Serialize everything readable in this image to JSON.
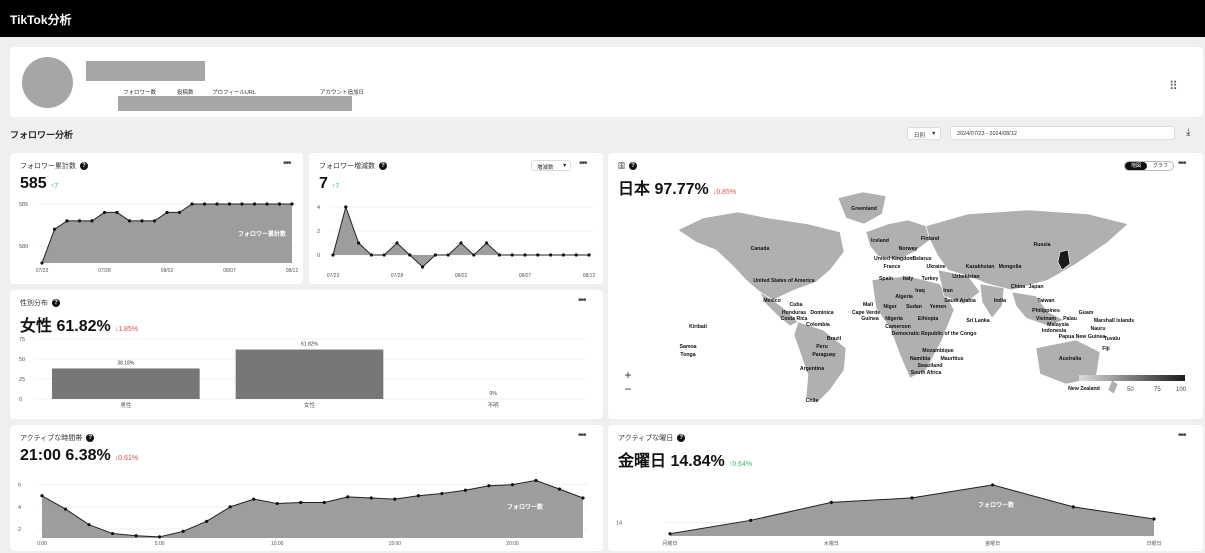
{
  "app": {
    "title": "TikTok分析"
  },
  "profile": {
    "labels": [
      "フォロワー数",
      "投稿数",
      "プロフィールURL",
      "アカウント追加日"
    ]
  },
  "follower_section": {
    "title": "フォロワー分析",
    "period_select": "日別",
    "date_range": "2024/07/23 - 2024/08/12"
  },
  "cards": {
    "total_followers": {
      "title": "フォロワー累計数",
      "value": "585",
      "delta": "↑7",
      "chart_data": {
        "type": "area",
        "series": [
          {
            "name": "フォロワー累計数",
            "values": [
              578,
              582,
              583,
              583,
              583,
              584,
              584,
              583,
              583,
              583,
              584,
              584,
              585,
              585,
              585,
              585,
              585,
              585,
              585,
              585,
              585
            ]
          }
        ],
        "x_ticks": [
          "07/23",
          "07/28",
          "08/02",
          "08/07",
          "08/12"
        ],
        "y_ticks": [
          "585",
          "580"
        ],
        "ylim": [
          578,
          585
        ]
      }
    },
    "follower_change": {
      "title": "フォロワー増減数",
      "select": "増減数",
      "value": "7",
      "delta": "↑7",
      "chart_data": {
        "type": "area",
        "series": [
          {
            "name": "フォロワー増減数",
            "values": [
              0,
              4,
              1,
              0,
              0,
              1,
              0,
              -1,
              0,
              0,
              1,
              0,
              1,
              0,
              0,
              0,
              0,
              0,
              0,
              0,
              0
            ]
          }
        ],
        "x_ticks": [
          "07/23",
          "07/28",
          "08/02",
          "08/07",
          "08/12"
        ],
        "y_ticks": [
          "4",
          "2",
          "0"
        ],
        "ylim": [
          -1,
          4
        ]
      }
    },
    "country": {
      "title": "国",
      "value": "日本 97.77%",
      "delta": "↓0.85%",
      "toggle": [
        "地図",
        "グラフ"
      ],
      "labels": [
        "Greenland",
        "Iceland",
        "Finland",
        "Norway",
        "Russia",
        "Canada",
        "United Kingdom",
        "Belarus",
        "France",
        "Ukraine",
        "Kazakhstan",
        "Mongolia",
        "Spain",
        "Italy",
        "Turkey",
        "Uzbekistan",
        "United States of America",
        "China",
        "Iraq",
        "Iran",
        "Japan",
        "Algeria",
        "Saudi Arabia",
        "India",
        "Taiwan",
        "Mexico",
        "Cuba",
        "Mali",
        "Niger",
        "Sudan",
        "Yemen",
        "Philippines",
        "Guam",
        "Honduras",
        "Dominica",
        "Cape Verde",
        "Guinea",
        "Nigeria",
        "Ethiopia",
        "Sri Lanka",
        "Vietnam",
        "Palau",
        "Marshall Islands",
        "Costa Rica",
        "Cameroon",
        "Malaysia",
        "Nauru",
        "Kiribati",
        "Colombia",
        "Democratic Republic of the Congo",
        "Indonesia",
        "Papua New Guinea",
        "Tuvalu",
        "Brazil",
        "Fiji",
        "Samoa",
        "Peru",
        "Tonga",
        "Paraguay",
        "Mozambique",
        "Namibia",
        "Mauritius",
        "Swaziland",
        "Argentina",
        "South Africa",
        "Australia",
        "New Zealand",
        "Chile"
      ],
      "legend": [
        "50",
        "75",
        "100"
      ]
    },
    "gender": {
      "title": "性別分布",
      "value": "女性 61.82%",
      "delta": "↓1.85%",
      "chart_data": {
        "type": "bar",
        "categories": [
          "男性",
          "女性",
          "不明"
        ],
        "values": [
          38.18,
          61.82,
          0
        ],
        "value_labels": [
          "38.18%",
          "61.82%",
          "0%"
        ],
        "y_ticks": [
          "75",
          "50",
          "25",
          "0"
        ],
        "ylim": [
          0,
          75
        ]
      }
    },
    "active_hours": {
      "title": "アクティブな時間帯",
      "value": "21:00 6.38%",
      "delta": "↓0.61%",
      "chart_data": {
        "type": "area",
        "series": [
          {
            "name": "フォロワー数",
            "values": [
              5.0,
              3.8,
              2.4,
              1.6,
              1.4,
              1.3,
              1.8,
              2.7,
              4.0,
              4.7,
              4.3,
              4.4,
              4.4,
              4.9,
              4.8,
              4.7,
              5.0,
              5.2,
              5.5,
              5.9,
              6.0,
              6.38,
              5.6,
              4.8
            ]
          }
        ],
        "x_ticks": [
          "0:00",
          "5:00",
          "10:00",
          "15:00",
          "20:00"
        ],
        "y_ticks": [
          "6",
          "4",
          "2"
        ],
        "ylim": [
          1.2,
          6.6
        ]
      }
    },
    "active_days": {
      "title": "アクティブな曜日",
      "value": "金曜日 14.84%",
      "delta": "↑0.64%",
      "chart_data": {
        "type": "area",
        "series": [
          {
            "name": "フォロワー数",
            "values": [
              13.75,
              14.05,
              14.45,
              14.55,
              14.84,
              14.35,
              14.08
            ]
          }
        ],
        "x_ticks": [
          "月曜日",
          "水曜日",
          "金曜日",
          "日曜日"
        ],
        "y_ticks": [
          "14"
        ],
        "ylim": [
          13.7,
          14.95
        ]
      }
    }
  },
  "icons": {
    "more": "more-horizontal-icon",
    "help": "help-circle-icon",
    "apps": "apps-grid-icon",
    "download": "download-icon",
    "caret": "caret-down-icon"
  }
}
